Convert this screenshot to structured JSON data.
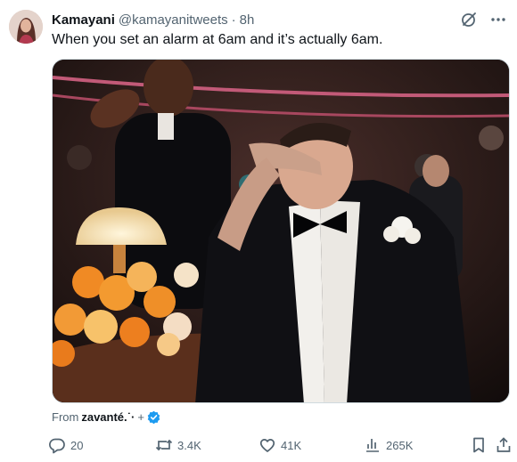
{
  "tweet": {
    "author_name": "Kamayani",
    "handle": "@kamayanitweets",
    "separator": "·",
    "time": "8h",
    "text": "When you set an alarm at 6am and it’s actually 6am."
  },
  "attribution": {
    "prefix": "From",
    "source": "zavanté.˙·",
    "plus": "+"
  },
  "actions": {
    "reply_count": "20",
    "repost_count": "3.4K",
    "like_count": "41K",
    "view_count": "265K"
  },
  "icons": {
    "top": [
      "grok-icon",
      "more-options-icon"
    ],
    "media": "photo-gif",
    "verified": "verified-badge-icon",
    "action_bar": [
      "reply-icon",
      "repost-icon",
      "like-icon",
      "views-icon",
      "bookmark-icon",
      "share-icon"
    ]
  },
  "colors": {
    "text": "#0f1419",
    "secondary_text": "#536471",
    "verified_blue": "#1d9bf0",
    "border": "#cfd9de"
  }
}
